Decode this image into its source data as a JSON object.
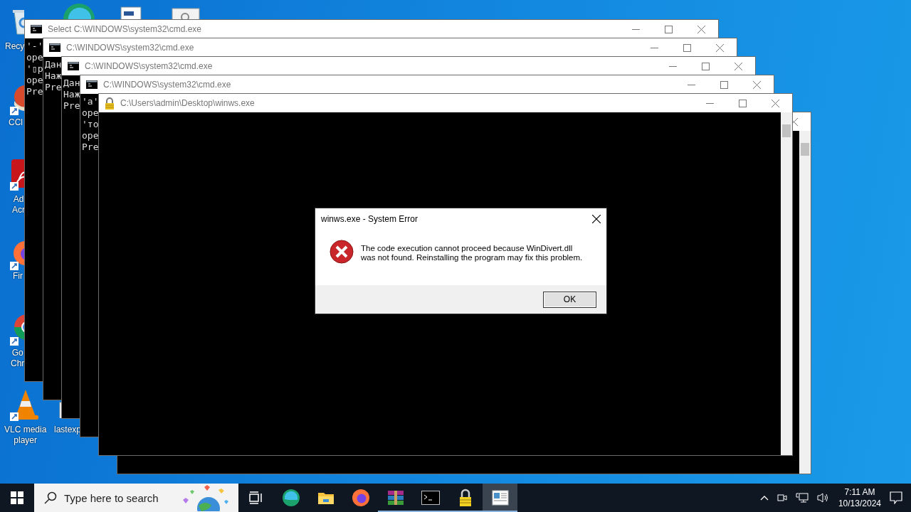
{
  "desktop_icons": [
    {
      "kind": "recycle-bin",
      "lines": [
        "Recy"
      ]
    },
    {
      "kind": "edge"
    },
    {
      "kind": "document"
    },
    {
      "kind": "settings-file"
    },
    {
      "kind": "ccleaner",
      "lines": [
        "CCl"
      ]
    },
    {
      "kind": "acrobat",
      "lines": [
        "Ad",
        "Acr"
      ]
    },
    {
      "kind": "firefox",
      "lines": [
        "Fir"
      ]
    },
    {
      "kind": "chrome",
      "lines": [
        "Go",
        "Chr"
      ]
    },
    {
      "kind": "vlc",
      "lines": [
        "VLC media",
        "player"
      ]
    },
    {
      "kind": "file",
      "lines": [
        "lastexp"
      ]
    }
  ],
  "windows": [
    {
      "kind": "console",
      "title": "Select C:\\WINDOWS\\system32\\cmd.exe",
      "lines": [
        "'-'",
        "ope",
        "'▯р",
        "ope",
        "Pre"
      ]
    },
    {
      "kind": "console",
      "title": "C:\\WINDOWS\\system32\\cmd.exe",
      "lines": [
        "Дан",
        "Наж",
        "Pre"
      ]
    },
    {
      "kind": "console",
      "title": "C:\\WINDOWS\\system32\\cmd.exe",
      "lines": [
        "Дан",
        "Наж",
        "Pre"
      ]
    },
    {
      "kind": "console",
      "title": "C:\\WINDOWS\\system32\\cmd.exe",
      "lines": [
        "'a'",
        "ope",
        "'то",
        "ope",
        "Pre"
      ]
    },
    {
      "kind": "locked-app",
      "title": "C:\\Users\\admin\\Desktop\\winws.exe"
    }
  ],
  "dialog": {
    "title": "winws.exe - System Error",
    "message": "The code execution cannot proceed because WinDivert.dll was not found. Reinstalling the program may fix this problem.",
    "button": "OK"
  },
  "taskbar": {
    "search_placeholder": "Type here to search",
    "apps": [
      {
        "kind": "task-view",
        "running": false,
        "selected": false
      },
      {
        "kind": "edge",
        "running": false,
        "selected": false
      },
      {
        "kind": "folder",
        "running": false,
        "selected": false
      },
      {
        "kind": "firefox",
        "running": false,
        "selected": false
      },
      {
        "kind": "archive",
        "running": true,
        "selected": false
      },
      {
        "kind": "console",
        "running": true,
        "selected": false
      },
      {
        "kind": "lock",
        "running": true,
        "selected": false
      },
      {
        "kind": "window",
        "running": true,
        "selected": true
      }
    ],
    "time": "7:11 AM",
    "date": "10/13/2024"
  }
}
